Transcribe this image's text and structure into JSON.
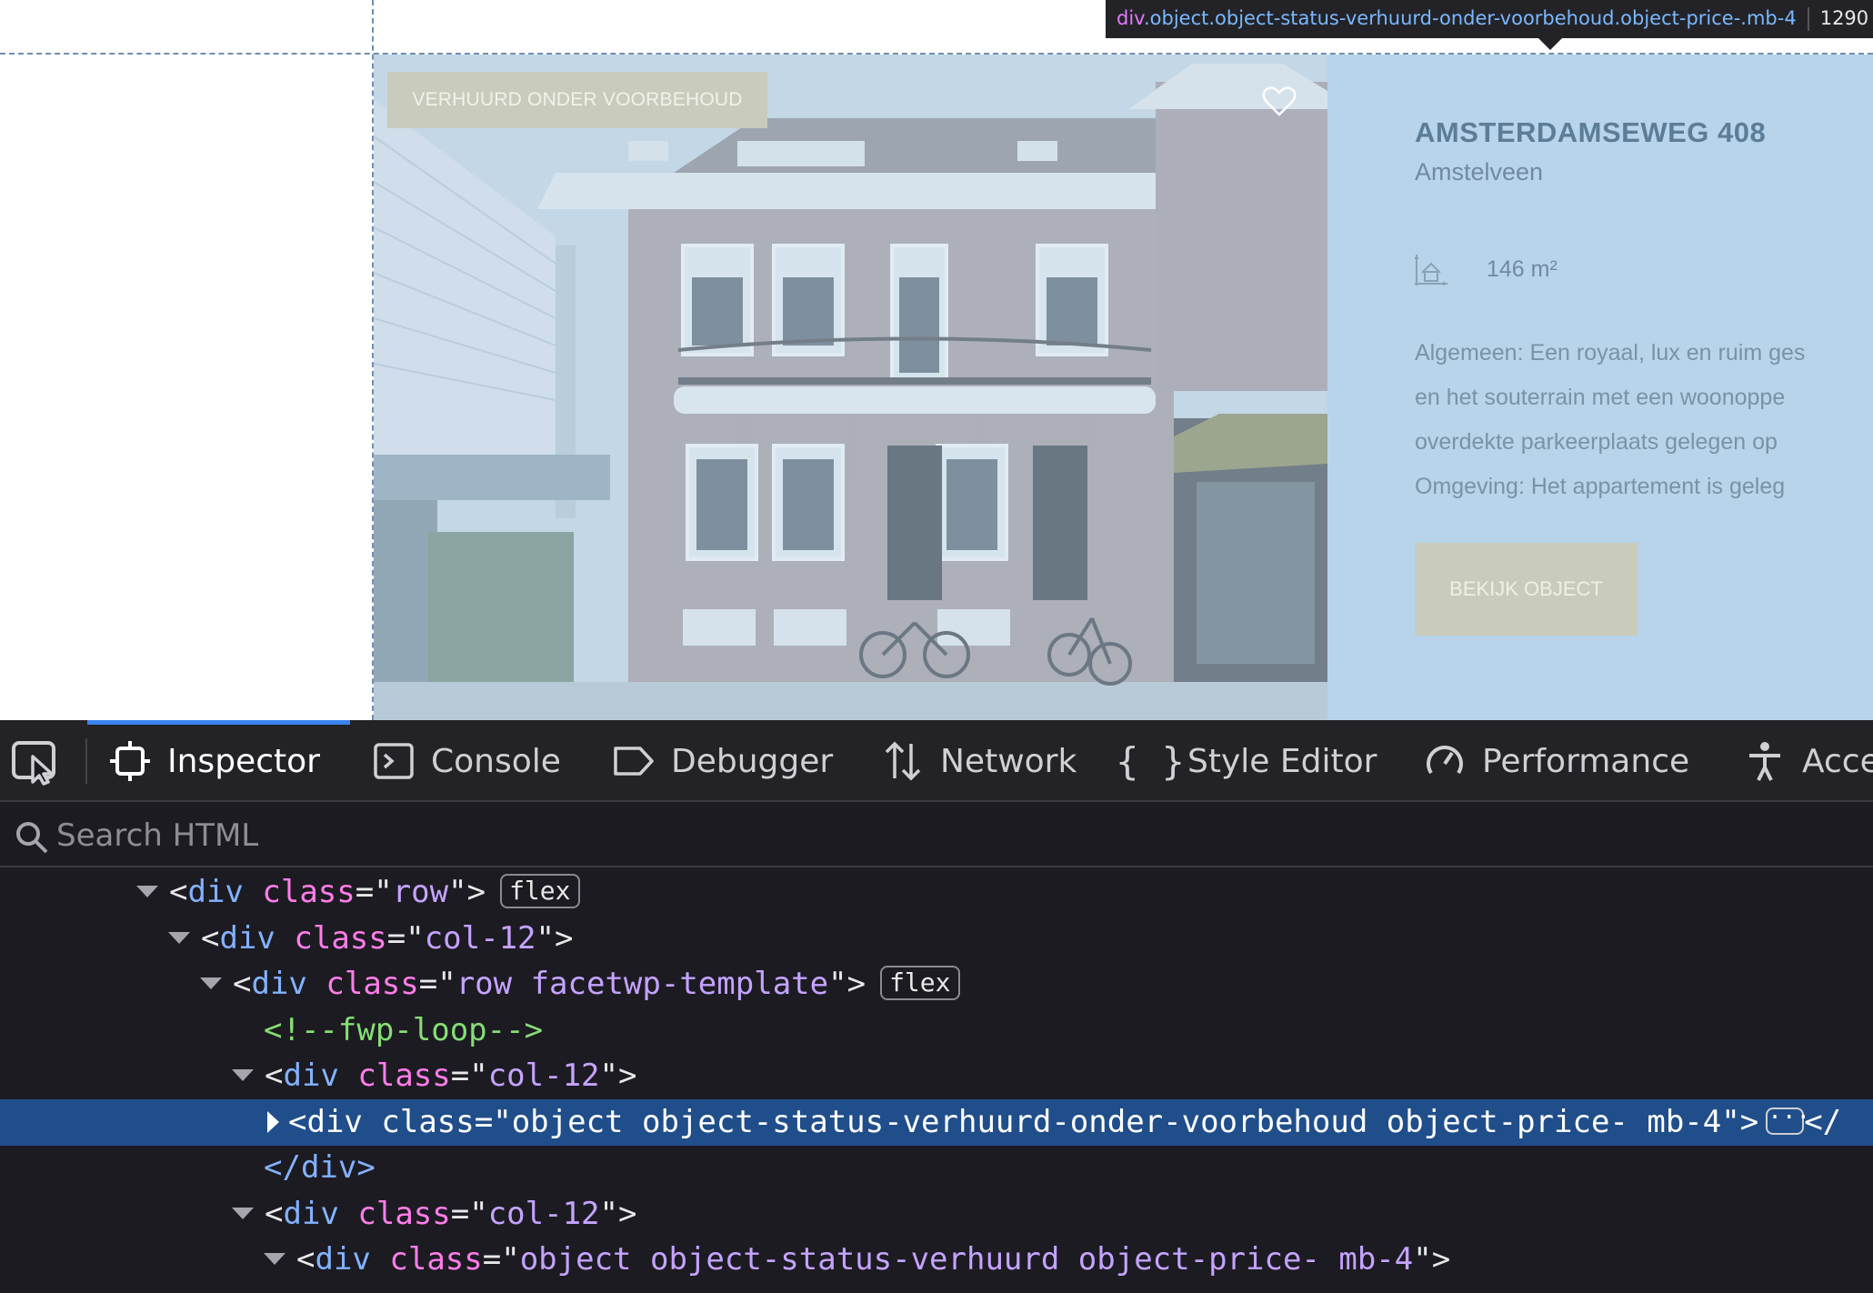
{
  "highlighter": {
    "selector_tag": "div",
    "selector_classes": ".object.object-status-verhuurd-onder-voorbehoud.object-price-.mb-4",
    "size_text": "1290"
  },
  "listing": {
    "status_badge": "VERHUURD ONDER VOORBEHOUD",
    "title": "AMSTERDAMSEWEG 408",
    "city": "Amstelveen",
    "area": "146 m²",
    "description_lines": [
      "Algemeen: Een royaal, lux en ruim ges",
      "en het souterrain met een woonoppe",
      "overdekte parkeerplaats gelegen op",
      "Omgeving: Het appartement is geleg"
    ],
    "button_label": "BEKIJK OBJECT",
    "colors": {
      "info_bg": "#b7d4ea",
      "title": "#5c7d98",
      "badge_bg": "#c9ccbc"
    }
  },
  "devtools": {
    "tabs": [
      {
        "label": "Inspector",
        "icon": "inspector-icon",
        "active": true
      },
      {
        "label": "Console",
        "icon": "console-icon",
        "active": false
      },
      {
        "label": "Debugger",
        "icon": "debugger-icon",
        "active": false
      },
      {
        "label": "Network",
        "icon": "network-icon",
        "active": false
      },
      {
        "label": "Style Editor",
        "icon": "style-editor-icon",
        "active": false
      },
      {
        "label": "Performance",
        "icon": "performance-icon",
        "active": false
      },
      {
        "label": "Acce",
        "icon": "accessibility-icon",
        "active": false
      }
    ],
    "search_placeholder": "Search HTML",
    "tree": {
      "n0": {
        "tag": "div",
        "attr": "class",
        "value": "row",
        "badge": "flex"
      },
      "n1": {
        "tag": "div",
        "attr": "class",
        "value": "col-12"
      },
      "n2": {
        "tag": "div",
        "attr": "class",
        "value": "row facetwp-template",
        "badge": "flex"
      },
      "n3": {
        "comment": "<!--fwp-loop-->"
      },
      "n4": {
        "tag": "div",
        "attr": "class",
        "value": "col-12"
      },
      "n5": {
        "tag": "div",
        "attr": "class",
        "value": "object object-status-verhuurd-onder-voorbehoud object-price- mb-4",
        "tail": "</"
      },
      "n6": {
        "close": "</div>"
      },
      "n7": {
        "tag": "div",
        "attr": "class",
        "value": "col-12"
      },
      "n8": {
        "tag": "div",
        "attr": "class",
        "value": "object object-status-verhuurd object-price- mb-4"
      }
    }
  }
}
